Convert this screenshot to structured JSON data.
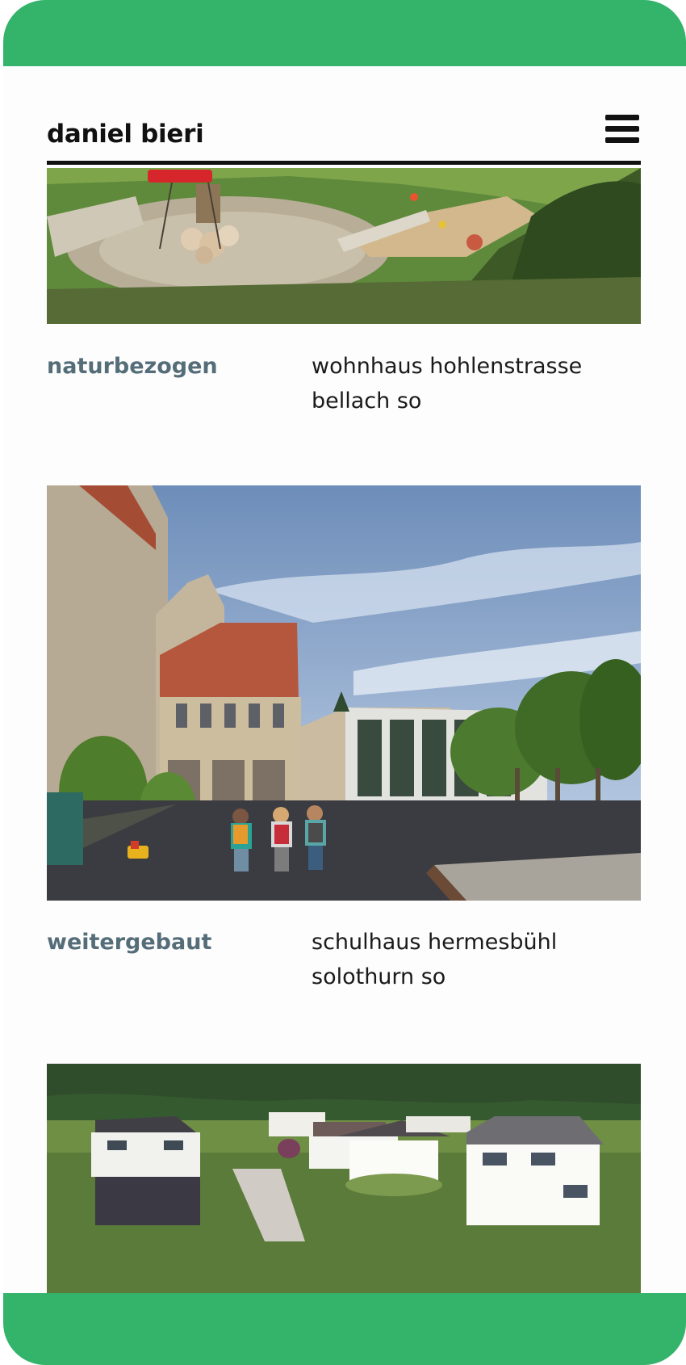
{
  "app": {
    "brand": "daniel bieri",
    "menu_icon": "hamburger-menu-icon"
  },
  "colors": {
    "frame": "#34b36b",
    "tag": "#556d79",
    "text": "#111111"
  },
  "projects": [
    {
      "category": "naturbezogen",
      "title_line1": "wohnhaus hohlenstrasse",
      "title_line2": "bellach so"
    },
    {
      "category": "weitergebaut",
      "title_line1": "schulhaus hermesbühl",
      "title_line2": "solothurn so"
    },
    {
      "category": "",
      "title_line1": "",
      "title_line2": ""
    }
  ]
}
